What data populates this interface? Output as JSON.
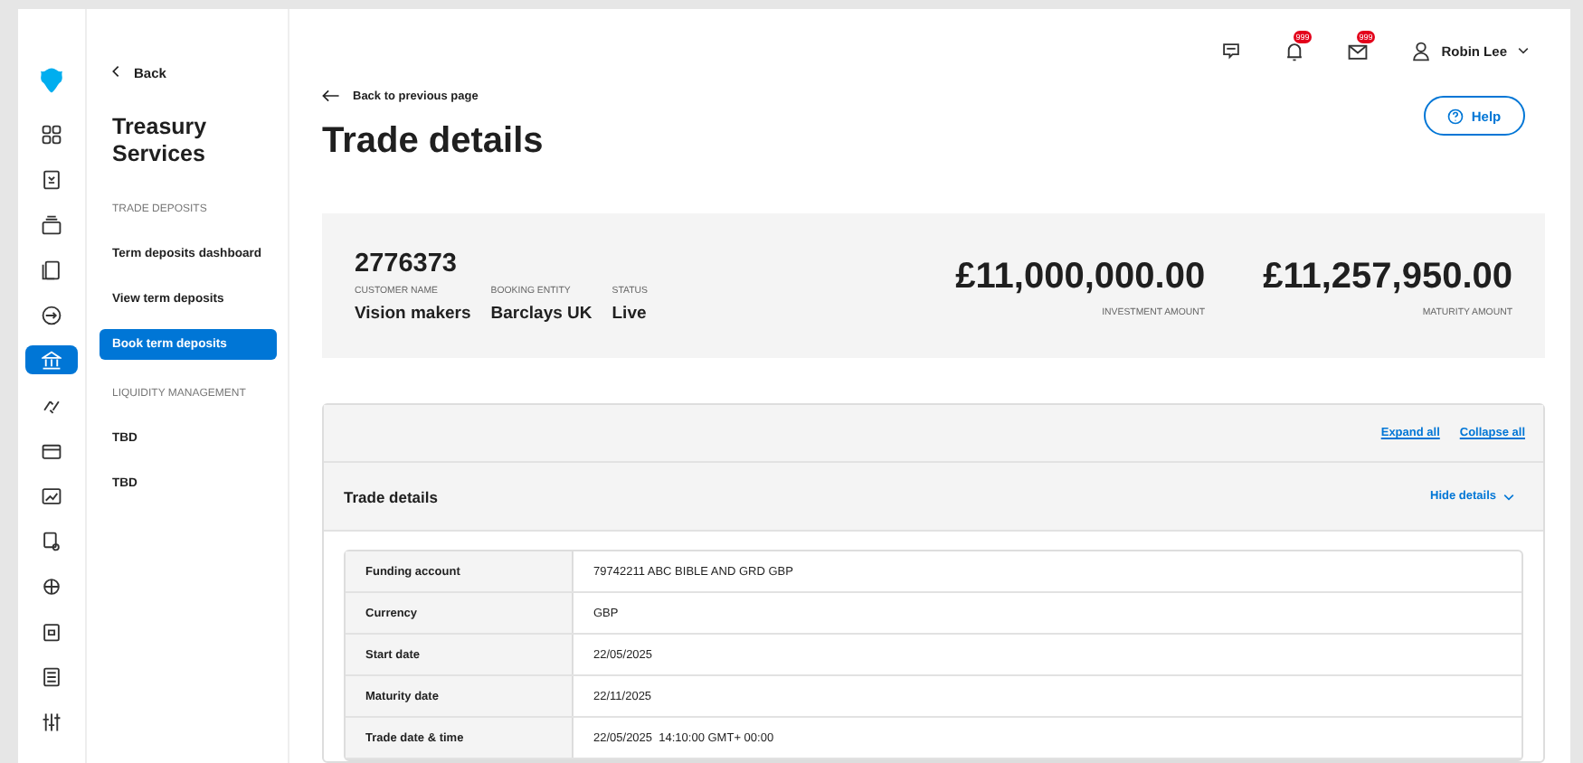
{
  "rail": [
    {
      "kind": "grid",
      "selected": false
    },
    {
      "kind": "checklist",
      "selected": false
    },
    {
      "kind": "tray",
      "selected": false
    },
    {
      "kind": "document",
      "selected": false
    },
    {
      "kind": "login",
      "selected": false
    },
    {
      "kind": "bank",
      "selected": true
    },
    {
      "kind": "transfer",
      "selected": false
    },
    {
      "kind": "card",
      "selected": false
    },
    {
      "kind": "chart",
      "selected": false
    },
    {
      "kind": "receipt",
      "selected": false
    },
    {
      "kind": "globe",
      "selected": false
    },
    {
      "kind": "calendar",
      "selected": false
    },
    {
      "kind": "list",
      "selected": false
    },
    {
      "kind": "sliders",
      "selected": false
    }
  ],
  "nav": {
    "back": "Back",
    "title": "Treasury Services",
    "sections": [
      {
        "heading": "TRADE DEPOSITS",
        "items": [
          {
            "label": "Term deposits dashboard",
            "selected": false
          },
          {
            "label": "View term deposits",
            "selected": false
          },
          {
            "label": "Book term deposits",
            "selected": true
          }
        ]
      },
      {
        "heading": "LIQUIDITY MANAGEMENT",
        "items": [
          {
            "label": "TBD",
            "selected": false
          },
          {
            "label": "TBD",
            "selected": false
          }
        ]
      }
    ]
  },
  "header": {
    "notifications_badge": "999",
    "mail_badge": "999",
    "user": "Robin Lee",
    "help": "Help"
  },
  "back_link": "Back to previous page",
  "title": "Trade details",
  "summary": {
    "reference": "2776373",
    "fields": [
      {
        "label": "CUSTOMER NAME",
        "value": "Vision makers"
      },
      {
        "label": "BOOKING ENTITY",
        "value": "Barclays UK"
      },
      {
        "label": "STATUS",
        "value": "Live"
      }
    ],
    "amounts": [
      {
        "value": "£11,000,000.00",
        "label": "INVESTMENT AMOUNT"
      },
      {
        "value": "£11,257,950.00",
        "label": "MATURITY AMOUNT"
      }
    ]
  },
  "accordion": {
    "expand_all": "Expand all",
    "collapse_all": "Collapse all",
    "section": {
      "title": "Trade details",
      "toggle": "Hide details",
      "expanded": true,
      "rows": [
        {
          "label": "Funding account",
          "value": "79742211 ABC BIBLE AND GRD GBP"
        },
        {
          "label": "Currency",
          "value": "GBP"
        },
        {
          "label": "Start date",
          "value": "22/05/2025"
        },
        {
          "label": "Maturity date",
          "value": "22/11/2025"
        },
        {
          "label": "Trade date & time",
          "value": "22/05/2025  14:10:00 GMT+ 00:00"
        }
      ]
    }
  }
}
